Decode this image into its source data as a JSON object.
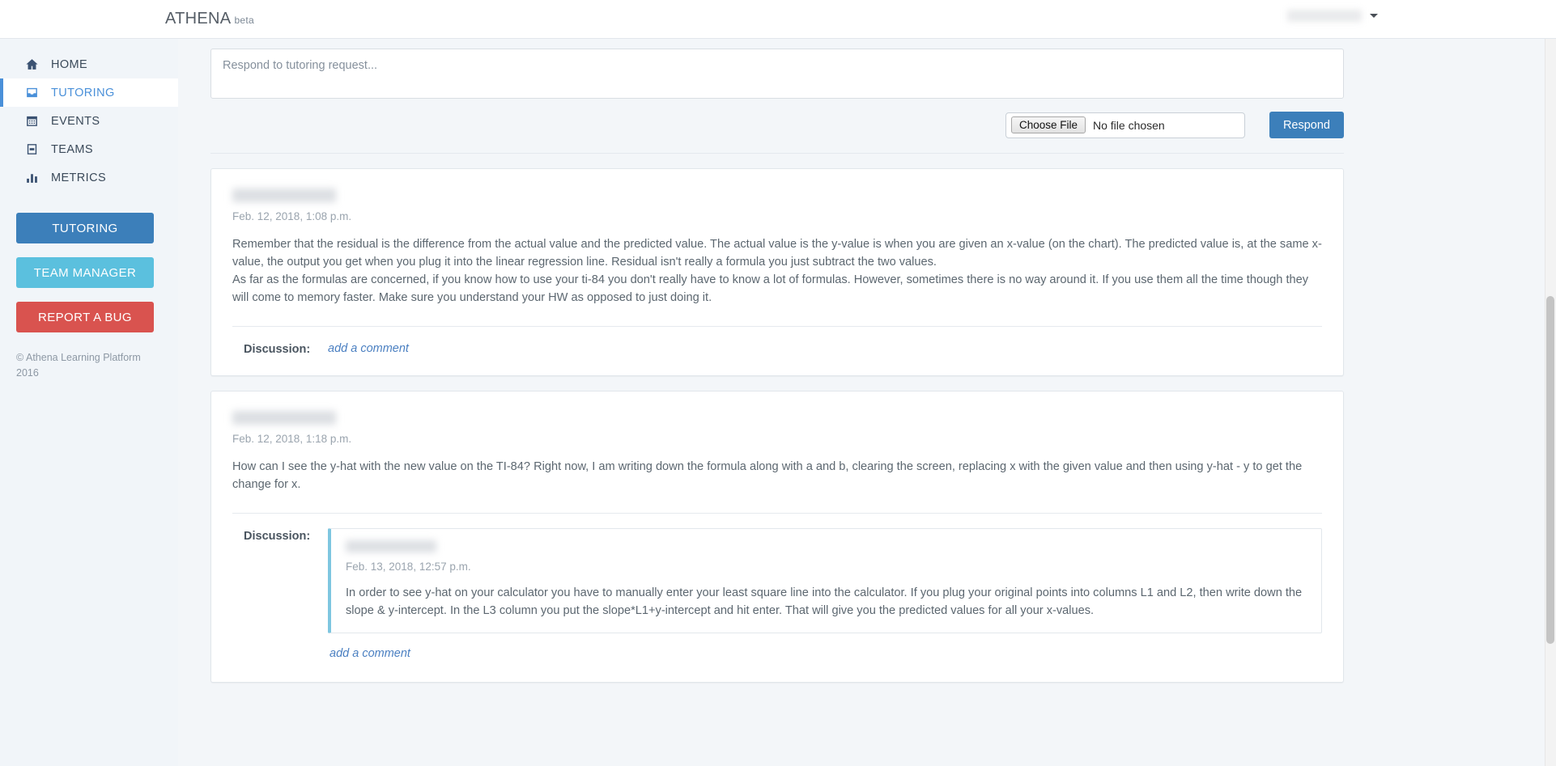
{
  "header": {
    "brand": "ATHENA",
    "brand_suffix": "beta",
    "user_name": "",
    "caret_icon": "chevron-down-icon"
  },
  "sidebar": {
    "items": [
      {
        "label": "HOME",
        "icon": "home-icon",
        "active": false
      },
      {
        "label": "TUTORING",
        "icon": "inbox-icon",
        "active": true
      },
      {
        "label": "EVENTS",
        "icon": "calendar-icon",
        "active": false
      },
      {
        "label": "TEAMS",
        "icon": "teams-icon",
        "active": false
      },
      {
        "label": "METRICS",
        "icon": "bar-chart-icon",
        "active": false
      }
    ],
    "buttons": [
      {
        "label": "TUTORING",
        "color": "#3c7fba"
      },
      {
        "label": "TEAM MANAGER",
        "color": "#5bc0de"
      },
      {
        "label": "REPORT A BUG",
        "color": "#d9534f"
      }
    ],
    "copyright": "© Athena Learning Platform 2016"
  },
  "compose": {
    "placeholder": "Respond to tutoring request...",
    "value": "",
    "choose_file_label": "Choose File",
    "no_file_text": "No file chosen",
    "respond_label": "Respond"
  },
  "posts": [
    {
      "author": "",
      "timestamp": "Feb. 12, 2018, 1:08 p.m.",
      "paragraph1": "Remember that the residual is the difference from the actual value and the predicted value. The actual value is the y-value is when you are given an x-value (on the chart). The predicted value is, at the same x-value, the output you get when you plug it into the linear regression line. Residual isn't really a formula you just subtract the two values.",
      "paragraph2": "As far as the formulas are concerned, if you know how to use your ti-84 you don't really have to know a lot of formulas. However, sometimes there is no way around it. If you use them all the time though they will come to memory faster. Make sure you understand your HW as opposed to just doing it.",
      "discussion_label": "Discussion:",
      "add_comment_label": "add a comment",
      "comments": []
    },
    {
      "author": "",
      "timestamp": "Feb. 12, 2018, 1:18 p.m.",
      "paragraph1": "How can I see the y-hat with the new value on the TI-84? Right now, I am writing down the formula along with a and b, clearing the screen, replacing x with the given value and then using y-hat - y to get the change for x.",
      "paragraph2": "",
      "discussion_label": "Discussion:",
      "add_comment_label": "add a comment",
      "comments": [
        {
          "author": "",
          "timestamp": "Feb. 13, 2018, 12:57 p.m.",
          "text": "In order to see y-hat on your calculator you have to manually enter your least square line into the calculator. If you plug your original points into columns L1 and L2, then write down the slope & y-intercept. In the L3 column you put the slope*L1+y-intercept and hit enter. That will give you the predicted values for all your x-values."
        }
      ]
    }
  ],
  "colors": {
    "accent": "#3c7fba",
    "link": "#4a7fc1",
    "danger": "#d9534f",
    "info": "#5bc0de",
    "page_bg": "#f3f6f9"
  }
}
